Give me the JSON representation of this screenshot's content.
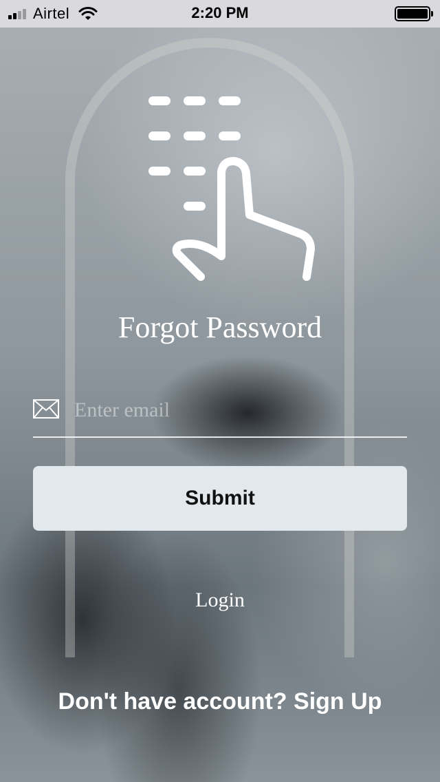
{
  "status_bar": {
    "carrier": "Airtel",
    "time": "2:20 PM",
    "signal_icon": "signal-icon",
    "wifi_icon": "wifi-icon",
    "battery_icon": "battery-icon"
  },
  "hero": {
    "icon": "touch-keypad-icon",
    "title": "Forgot Password"
  },
  "form": {
    "email_icon": "mail-icon",
    "email_placeholder": "Enter email",
    "email_value": "",
    "submit_label": "Submit"
  },
  "links": {
    "login_label": "Login",
    "signup_prompt": "Don't have account?",
    "signup_label": "Sign Up"
  },
  "colors": {
    "button_background": "#e2e8eb",
    "text": "#ffffff",
    "status_bar_background": "#d9d9de"
  }
}
